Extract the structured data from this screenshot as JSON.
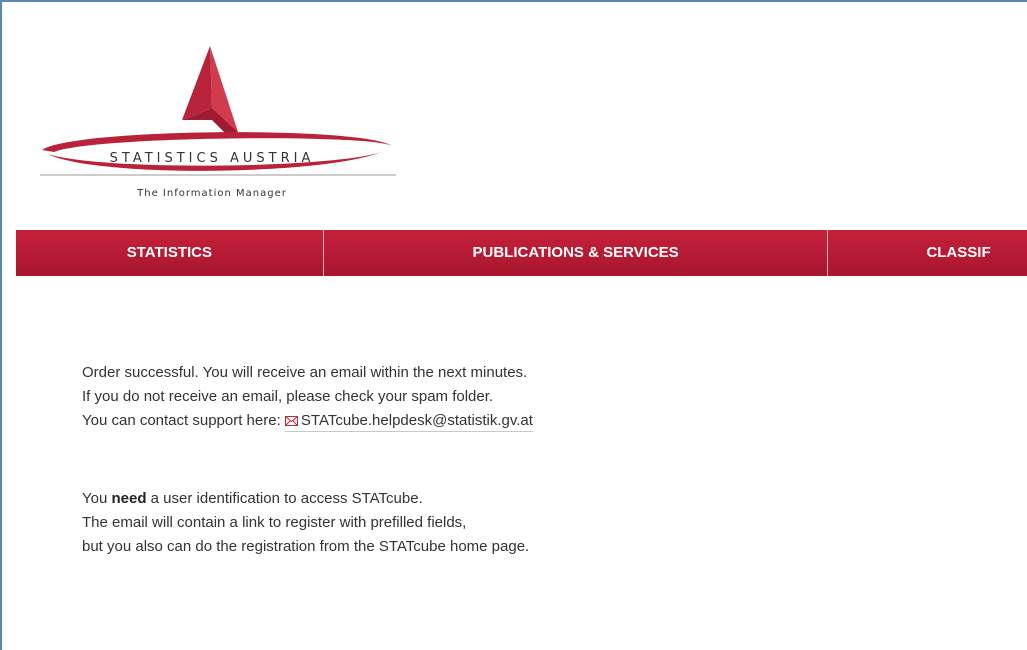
{
  "logo": {
    "name": "STATISTICS AUSTRIA",
    "tagline": "The Information Manager"
  },
  "nav": {
    "items": [
      {
        "label": "STATISTICS"
      },
      {
        "label": "PUBLICATIONS & SERVICES"
      },
      {
        "label": "CLASSIF"
      }
    ]
  },
  "message": {
    "line1": "Order successful. You will receive an email within the next minutes.",
    "line2": "If you do not receive an email, please check your spam folder.",
    "line3_prefix": "You can contact support here:",
    "support_email": "STATcube.helpdesk@statistik.gv.at",
    "line4_before": "You",
    "line4_bold": "need",
    "line4_after": "a user identification to access STATcube.",
    "line5": "The email will contain a link to register with prefilled fields,",
    "line6": "but you also can do the registration from the STATcube home page."
  },
  "colors": {
    "nav_red": "#b51a31",
    "logo_red": "#c0283a",
    "frame_blue": "#5a86b8"
  },
  "icons": {
    "mail": "envelope-icon"
  }
}
